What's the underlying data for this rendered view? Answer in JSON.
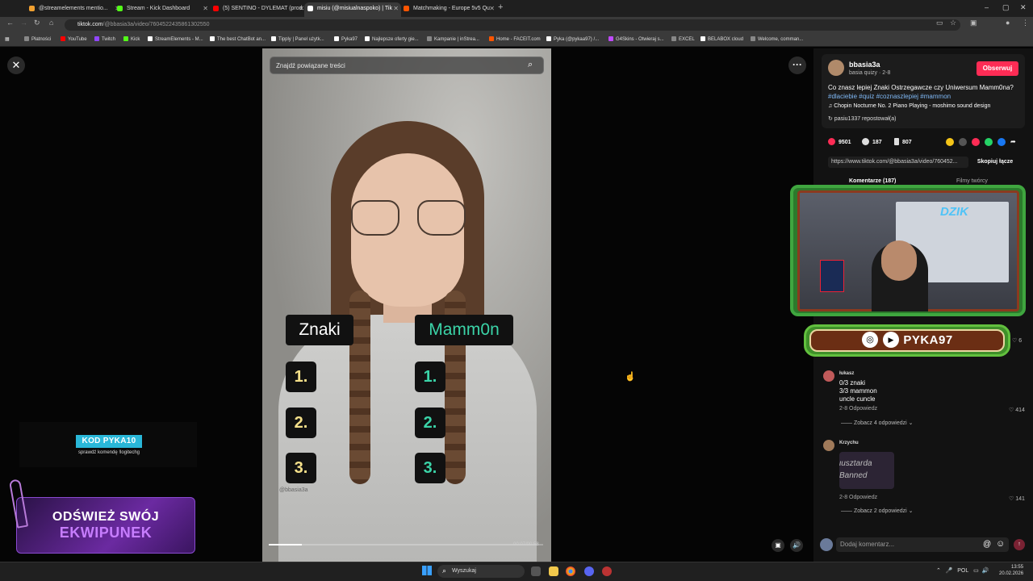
{
  "browser": {
    "tabs": [
      {
        "title": "@streamelements mentio...",
        "color": "#f0a030"
      },
      {
        "title": "Stream - Kick Dashboard",
        "color": "#53fc18"
      },
      {
        "title": "(5) SENTINO - DYLEMAT (prod.",
        "color": "#ff0000"
      },
      {
        "title": "misiu (@misiualnaspoko) | Tik",
        "color": "#ffffff"
      },
      {
        "title": "Matchmaking - Europe 5v5 Qu",
        "color": "#ff5500"
      }
    ],
    "new_tab": "+",
    "url_host": "tiktok.com",
    "url_path": "/@bbasia3a/video/7604522435861302550",
    "window_controls": [
      "–",
      "▢",
      "✕"
    ]
  },
  "bookmarks": [
    {
      "label": "Płatności",
      "color": "#888"
    },
    {
      "label": "YouTube",
      "color": "#ff0000"
    },
    {
      "label": "Twitch",
      "color": "#9146ff"
    },
    {
      "label": "Kick",
      "color": "#53fc18"
    },
    {
      "label": "StreamElements - M...",
      "color": "#ffffff"
    },
    {
      "label": "The best ChatBot an...",
      "color": "#ffffff"
    },
    {
      "label": "Tipply | Panel użytk...",
      "color": "#ffffff"
    },
    {
      "label": "Pyka97",
      "color": "#ffffff"
    },
    {
      "label": "Najlepsze oferty gie...",
      "color": "#ffffff"
    },
    {
      "label": "Kampanie | inStrea...",
      "color": "#888"
    },
    {
      "label": "Home - FACEIT.com",
      "color": "#ff5500"
    },
    {
      "label": "Pyka (@pykaa97) /...",
      "color": "#ffffff"
    },
    {
      "label": "G4Skins - Otwieraj s...",
      "color": "#c04aff"
    },
    {
      "label": "EXCEL",
      "color": "#888"
    },
    {
      "label": "BELABOX cloud",
      "color": "#ffffff"
    },
    {
      "label": "Welcome, comman...",
      "color": "#888"
    }
  ],
  "video": {
    "search_placeholder": "Znajdź powiązane treści",
    "label_left": "Znaki",
    "label_right": "Mamm0n",
    "numbers": [
      "1.",
      "2.",
      "3."
    ],
    "watermark": "@bbasia3a",
    "time": "00:07/00:58",
    "progress": 0.12,
    "left_label_color": "#ffffff",
    "right_label_color": "#3bd4a8",
    "left_num_color": "#f5e08a",
    "right_num_color": "#3bd4a8"
  },
  "overlay": {
    "code": "KOD PYKA10",
    "code_sub": "sprawdź komendę !logitechg",
    "promo_line1": "ODŚWIEŻ SWÓJ",
    "promo_line2": "EKWIPUNEK"
  },
  "post": {
    "username": "bbasia3a",
    "subtitle": "basia quizy · 2-8",
    "follow": "Obserwuj",
    "description": "Co znasz lepiej Znaki Ostrzegawcze czy Uniwersum Mamm0na?",
    "tags": "#dlaciebie #quiz #coznaszlepiej #mammon",
    "music": "♫  Chopin Nocturne No. 2 Piano Playing - moshimo sound design",
    "repost": "↻  pasiu1337 repostował(a)",
    "likes": "9501",
    "comments": "187",
    "saves": "807",
    "share_url": "https://www.tiktok.com/@bbasia3a/video/760452...",
    "copy_link": "Skopiuj łącze",
    "tab_comments": "Komentarze (187)",
    "tab_creator": "Filmy twórcy"
  },
  "stream": {
    "channel": "PYKA97",
    "logo": "DZIK",
    "banner_like_count": "6"
  },
  "comments": [
    {
      "author": "łukasz",
      "lines": [
        "0/3 znaki",
        "3/3 mammon",
        "uncle cuncle"
      ],
      "meta": "2-8    Odpowiedz",
      "likes": "414",
      "more": "—— Zobacz 4 odpowiedzi ⌄"
    },
    {
      "author": "Krzychu",
      "sticker_line1": "ιusztarda",
      "sticker_line2": "Banned",
      "meta": "2-8    Odpowiedz",
      "likes": "141",
      "more": "—— Zobacz 2 odpowiedzi ⌄"
    }
  ],
  "comment_input": {
    "placeholder": "Dodaj komentarz...",
    "mention": "@",
    "emoji": "☺",
    "send": "↑"
  },
  "taskbar": {
    "search": "Wyszukaj",
    "lang": "POL",
    "time": "13:55",
    "date": "20.02.2026"
  }
}
